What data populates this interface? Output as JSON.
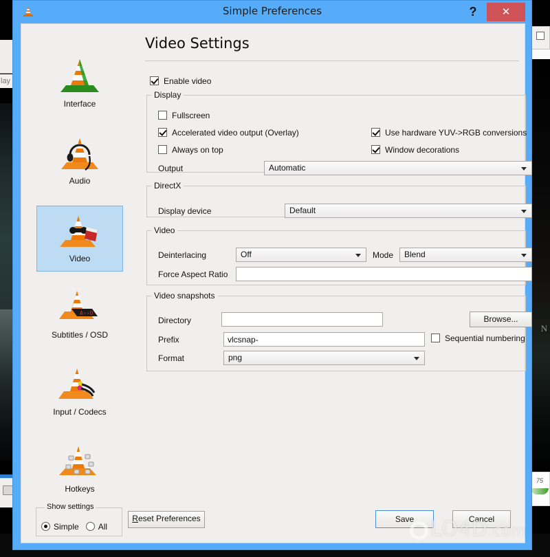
{
  "window": {
    "title": "Simple Preferences",
    "app_icon": "vlc-cone-icon",
    "help_label": "?",
    "close_label": "✕",
    "titlebar_color": "#56ACF8",
    "close_color": "#CF5356"
  },
  "sidebar": {
    "items": [
      {
        "label": "Interface",
        "icon": "vlc-cone-interface-icon",
        "selected": false
      },
      {
        "label": "Audio",
        "icon": "vlc-cone-headphones-icon",
        "selected": false
      },
      {
        "label": "Video",
        "icon": "vlc-cone-clapper-icon",
        "selected": true
      },
      {
        "label": "Subtitles / OSD",
        "icon": "vlc-cone-subtitles-icon",
        "selected": false
      },
      {
        "label": "Input / Codecs",
        "icon": "vlc-cone-cables-icon",
        "selected": false
      },
      {
        "label": "Hotkeys",
        "icon": "vlc-cone-keyboard-icon",
        "selected": false
      }
    ],
    "selected_color": "#BDDCF4"
  },
  "page": {
    "title": "Video Settings",
    "enable_video": {
      "label": "Enable video",
      "checked": true
    },
    "display": {
      "legend": "Display",
      "fullscreen": {
        "label": "Fullscreen",
        "checked": false
      },
      "accelerated": {
        "label": "Accelerated video output (Overlay)",
        "checked": true
      },
      "always_on_top": {
        "label": "Always on top",
        "checked": false
      },
      "yuv_rgb": {
        "label": "Use hardware YUV->RGB conversions",
        "checked": true
      },
      "decorations": {
        "label": "Window decorations",
        "checked": true
      },
      "output_label": "Output",
      "output_value": "Automatic"
    },
    "directx": {
      "legend": "DirectX",
      "display_device_label": "Display device",
      "display_device_value": "Default"
    },
    "video": {
      "legend": "Video",
      "deinterlacing_label": "Deinterlacing",
      "deinterlacing_value": "Off",
      "mode_label": "Mode",
      "mode_value": "Blend",
      "aspect_label": "Force Aspect Ratio",
      "aspect_value": "",
      "aspect_placeholder": ""
    },
    "snapshots": {
      "legend": "Video snapshots",
      "directory_label": "Directory",
      "directory_value": "",
      "browse_label": "Browse...",
      "prefix_label": "Prefix",
      "prefix_value": "vlcsnap-",
      "sequential": {
        "label": "Sequential numbering",
        "checked": false
      },
      "format_label": "Format",
      "format_value": "png"
    }
  },
  "bottom": {
    "show_settings_legend": "Show settings",
    "simple_label": "Simple",
    "all_label": "All",
    "simple_selected": true,
    "reset_label": "Reset Preferences",
    "reset_mnemonic": "R",
    "save_label": "Save",
    "save_mnemonic": "a",
    "cancel_label": "Cancel",
    "cancel_mnemonic": "a"
  },
  "watermark": {
    "text": "LO4D",
    "suffix": ".com"
  },
  "background": {
    "word": "lay",
    "number": "75"
  }
}
